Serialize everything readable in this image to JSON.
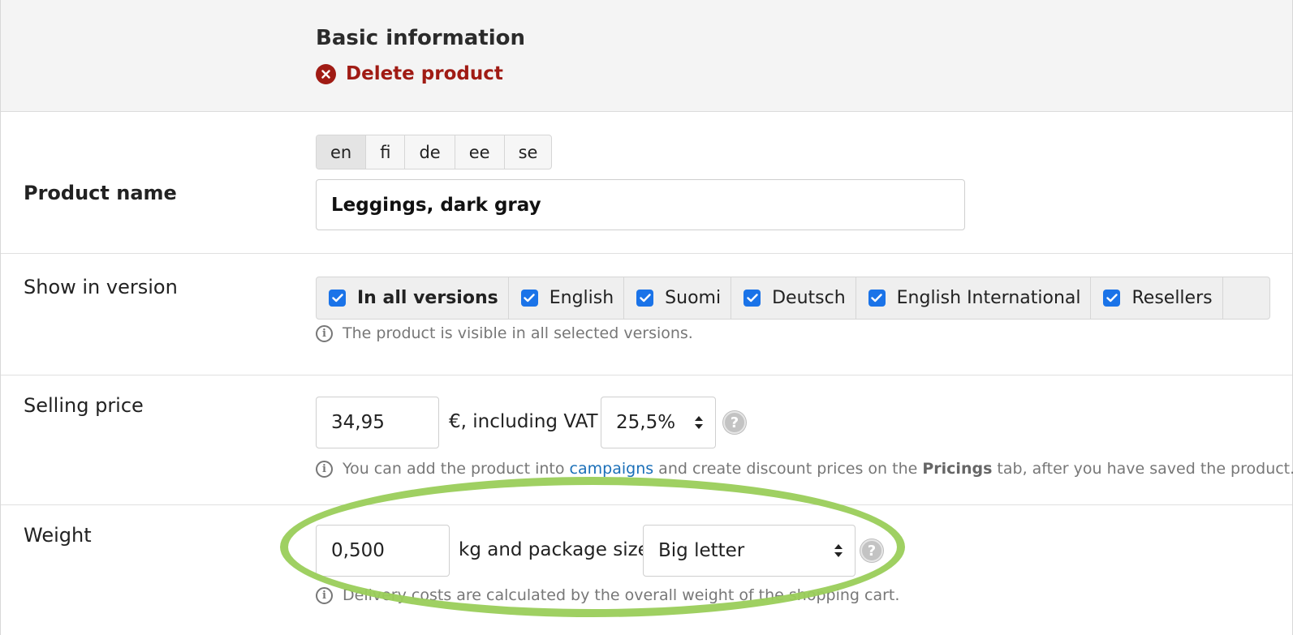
{
  "header": {
    "title": "Basic information",
    "delete_label": "Delete product"
  },
  "product_name": {
    "label": "Product name",
    "languages": [
      "en",
      "fi",
      "de",
      "ee",
      "se"
    ],
    "active_language": "en",
    "value": "Leggings, dark gray"
  },
  "versions": {
    "label": "Show in version",
    "items": [
      {
        "label": "In all versions",
        "checked": true
      },
      {
        "label": "English",
        "checked": true
      },
      {
        "label": "Suomi",
        "checked": true
      },
      {
        "label": "Deutsch",
        "checked": true
      },
      {
        "label": "English International",
        "checked": true
      },
      {
        "label": "Resellers",
        "checked": true
      }
    ],
    "help": "The product is visible in all selected versions."
  },
  "price": {
    "label": "Selling price",
    "value": "34,95",
    "suffix": "€, including VAT",
    "vat": "25,5%",
    "help_before": "You can add the product into ",
    "help_link": "campaigns",
    "help_middle": " and create discount prices on the ",
    "help_bold": "Pricings",
    "help_after": " tab, after you have saved the product."
  },
  "weight": {
    "label": "Weight",
    "value": "0,500",
    "suffix": "kg and package size",
    "package_size": "Big letter",
    "help": "Delivery costs are calculated by the overall weight of the shopping cart."
  },
  "colors": {
    "delete": "#a01b14",
    "checkbox": "#1a73e8",
    "link": "#1a6fb8",
    "highlight": "#9acd5a"
  }
}
